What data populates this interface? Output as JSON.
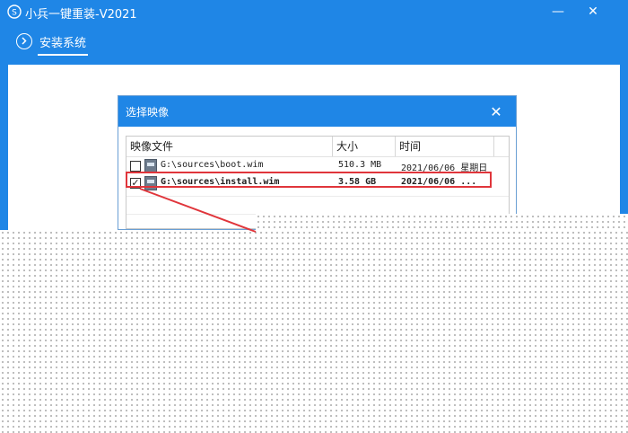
{
  "window": {
    "title": "小兵一键重装-V2021",
    "minimize_glyph": "—",
    "close_glyph": "✕"
  },
  "tabs": [
    {
      "label": "安装系统",
      "active": true
    }
  ],
  "dialog": {
    "title": "选择映像",
    "close_glyph": "✕",
    "columns": {
      "name": "映像文件",
      "size": "大小",
      "time": "时间"
    },
    "rows": [
      {
        "checked": false,
        "name": "G:\\sources\\boot.wim",
        "size": "510.3 MB",
        "time": "2021/06/06 星期日"
      },
      {
        "checked": true,
        "name": "G:\\sources\\install.wim",
        "size": "3.58 GB",
        "time": "2021/06/06 ..."
      }
    ]
  },
  "colors": {
    "accent": "#1f86e6",
    "highlight": "#e0353b"
  },
  "icons": {
    "app_logo": "app-logo-icon",
    "tab": "chevron-right-circle-icon",
    "file": "disk-image-icon"
  }
}
